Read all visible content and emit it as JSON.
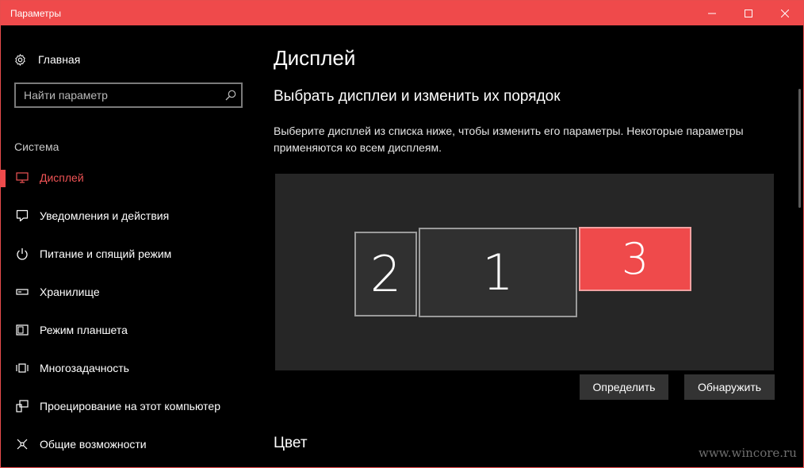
{
  "window": {
    "title": "Параметры",
    "accent_color": "#ef4a4b"
  },
  "sidebar": {
    "home_label": "Главная",
    "search_placeholder": "Найти параметр",
    "section_label": "Система",
    "items": [
      {
        "label": "Дисплей",
        "icon": "monitor-icon",
        "active": true
      },
      {
        "label": "Уведомления и действия",
        "icon": "notification-icon",
        "active": false
      },
      {
        "label": "Питание и спящий режим",
        "icon": "power-icon",
        "active": false
      },
      {
        "label": "Хранилище",
        "icon": "storage-icon",
        "active": false
      },
      {
        "label": "Режим планшета",
        "icon": "tablet-mode-icon",
        "active": false
      },
      {
        "label": "Многозадачность",
        "icon": "multitasking-icon",
        "active": false
      },
      {
        "label": "Проецирование на этот компьютер",
        "icon": "projecting-icon",
        "active": false
      },
      {
        "label": "Общие возможности",
        "icon": "shared-experiences-icon",
        "active": false
      }
    ]
  },
  "main": {
    "title": "Дисплей",
    "subheading": "Выбрать дисплеи и изменить их порядок",
    "description": "Выберите дисплей из списка ниже, чтобы изменить его параметры. Некоторые параметры применяются ко всем дисплеям.",
    "monitors": [
      {
        "number": "2",
        "selected": false
      },
      {
        "number": "1",
        "selected": false
      },
      {
        "number": "3",
        "selected": true
      }
    ],
    "identify_label": "Определить",
    "detect_label": "Обнаружить",
    "color_heading": "Цвет"
  },
  "watermark": "www.wincore.ru"
}
